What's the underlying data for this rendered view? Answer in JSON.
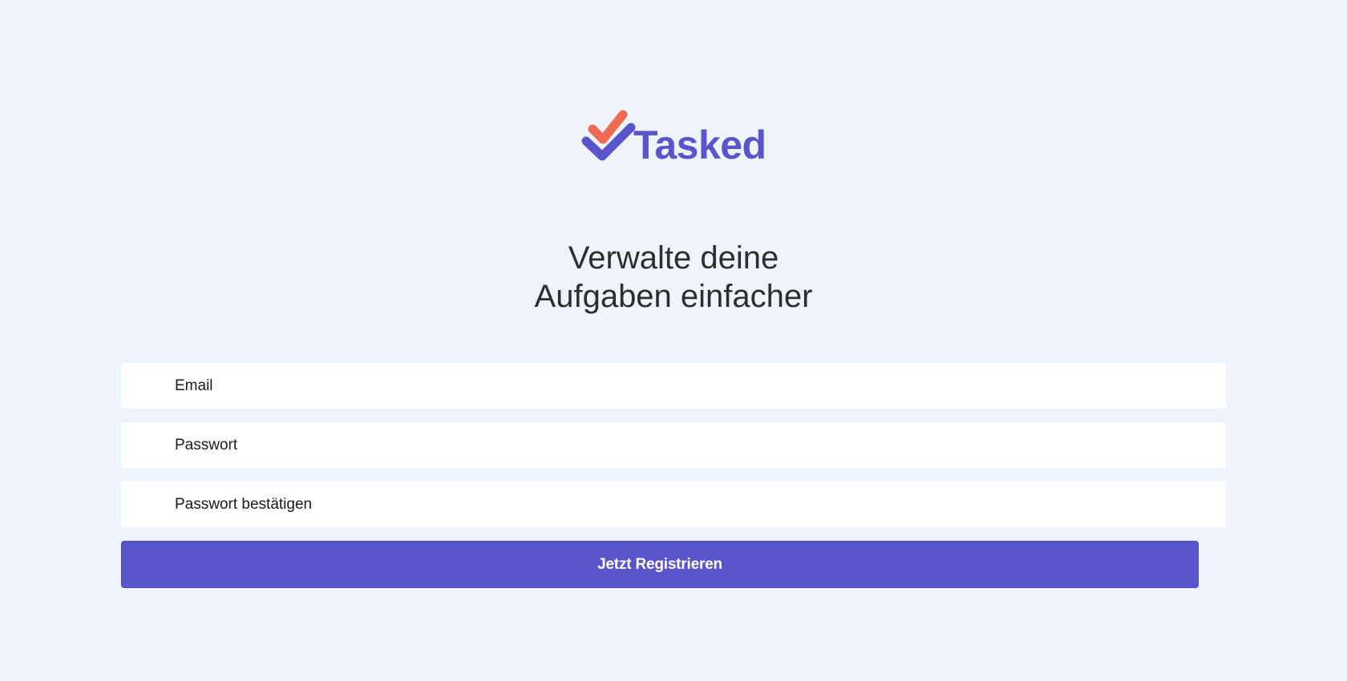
{
  "brand": {
    "name": "Tasked",
    "icon": "double-checkmark-icon",
    "colors": {
      "primary": "#5b55cc",
      "accent": "#ef6a52"
    }
  },
  "headline": {
    "line1": "Verwalte deine",
    "line2": "Aufgaben einfacher"
  },
  "form": {
    "email": {
      "placeholder": "Email",
      "value": ""
    },
    "password": {
      "placeholder": "Passwort",
      "value": ""
    },
    "password_confirm": {
      "placeholder": "Passwort bestätigen",
      "value": ""
    },
    "submit_label": "Jetzt Registrieren"
  },
  "theme": {
    "background": "#eef3fc",
    "field_background": "#ffffff",
    "text": "#2e2e2e"
  }
}
